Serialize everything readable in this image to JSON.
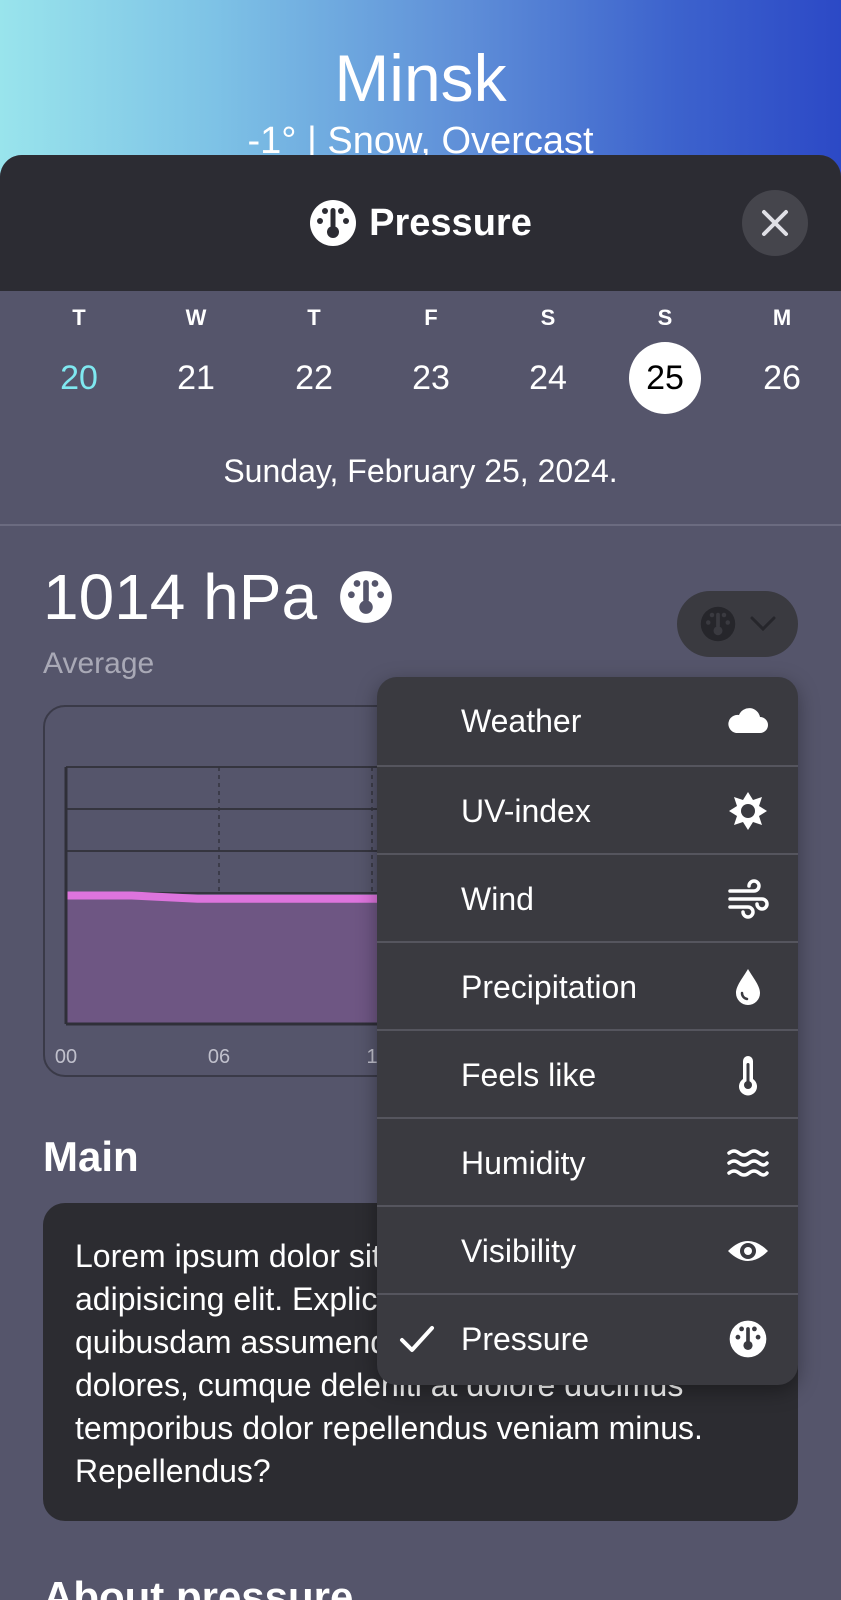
{
  "header": {
    "city": "Minsk",
    "summary": "-1° | Snow, Overcast"
  },
  "sheet": {
    "title": "Pressure",
    "title_icon": "gauge-icon",
    "close_icon": "close-icon"
  },
  "days": [
    {
      "dow": "T",
      "num": "20",
      "state": "today"
    },
    {
      "dow": "W",
      "num": "21",
      "state": ""
    },
    {
      "dow": "T",
      "num": "22",
      "state": ""
    },
    {
      "dow": "F",
      "num": "23",
      "state": ""
    },
    {
      "dow": "S",
      "num": "24",
      "state": ""
    },
    {
      "dow": "S",
      "num": "25",
      "state": "selected"
    },
    {
      "dow": "M",
      "num": "26",
      "state": ""
    }
  ],
  "date_line": "Sunday, February 25, 2024.",
  "current": {
    "value": "1014 hPa",
    "label": "Average"
  },
  "chart_data": {
    "type": "area",
    "x_ticks_visible": [
      "00",
      "06",
      "1"
    ],
    "series": [
      {
        "values": [
          1014.0,
          1014.0,
          1013.9,
          1013.9,
          1013.9,
          1013.9,
          1013.8,
          1014.3,
          1014.3,
          1014.3,
          1014.2,
          1014.2
        ]
      }
    ],
    "series_color": "#dd74dd",
    "fill_color": "#6e5683",
    "grid": true
  },
  "menu": {
    "items": [
      {
        "label": "Weather",
        "icon": "cloud-icon",
        "checked": false
      },
      {
        "label": "UV-index",
        "icon": "sun-icon",
        "checked": false
      },
      {
        "label": "Wind",
        "icon": "wind-icon",
        "checked": false
      },
      {
        "label": "Precipitation",
        "icon": "droplet-icon",
        "checked": false
      },
      {
        "label": "Feels like",
        "icon": "thermometer-icon",
        "checked": false
      },
      {
        "label": "Humidity",
        "icon": "waves-icon",
        "checked": false
      },
      {
        "label": "Visibility",
        "icon": "eye-icon",
        "checked": false
      },
      {
        "label": "Pressure",
        "icon": "gauge-icon",
        "checked": true
      }
    ]
  },
  "main": {
    "heading": "Main",
    "text": "Lorem ipsum dolor sit amet consectetur adipisicing elit. Explicabo ipsum omnis quibusdam assumenda nesciunt magnam quis dolores, cumque deleniti at dolore ducimus temporibus dolor repellendus veniam minus. Repellendus?"
  },
  "about": {
    "heading": "About pressure"
  },
  "colors": {
    "accent_today": "#7fe8f0",
    "sheet_bg": "#55556b",
    "header_bg": "#2c2c33",
    "menu_bg": "#3a3a40"
  }
}
